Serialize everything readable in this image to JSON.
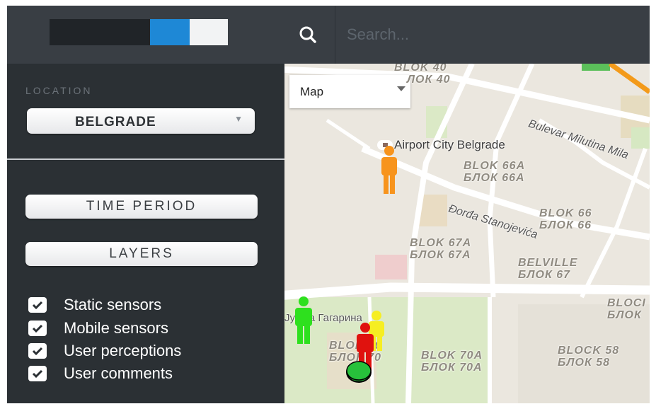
{
  "header": {
    "search_placeholder": "Search...",
    "logo_colors": [
      "#202428",
      "#1e88d6",
      "#f2f3f4"
    ]
  },
  "sidebar": {
    "location_label": "LOCATION",
    "location_value": "BELGRADE",
    "time_period_label": "TIME PERIOD",
    "layers_label": "LAYERS",
    "checkboxes": [
      {
        "label": "Static sensors",
        "checked": true
      },
      {
        "label": "Mobile sensors",
        "checked": true
      },
      {
        "label": "User perceptions",
        "checked": true
      },
      {
        "label": "User comments",
        "checked": true
      }
    ]
  },
  "map": {
    "type_selected": "Map",
    "poi": "Airport City Belgrade",
    "streets": [
      "Bulevar Milutina Mila",
      "Đorđa Stanojevića",
      "Јурија Гагарина"
    ],
    "labels": {
      "blok40_lat": "BLOK 40",
      "blok40_cyr": "ЛОК 40",
      "blok66a_lat": "BLOK 66A",
      "blok66a_cyr": "БЛОК 66А",
      "blok66_lat": "BLOK 66",
      "blok66_cyr": "БЛОК 66",
      "blok67a_lat": "BLOK 67A",
      "blok67a_cyr": "БЛОК 67А",
      "belville_lat": "BELVILLE",
      "belville_cyr": "БЛОК 67",
      "blok70_lat": "BLOK 70",
      "blok70_cyr": "БЛОК 70",
      "blok70a_lat": "BLOK 70A",
      "blok70a_cyr": "БЛОК 70А",
      "block58_lat": "BLOCK 58",
      "block58_cyr": "БЛОК 58",
      "right_lat": "BLOCI",
      "right_cyr": "БЛОК"
    },
    "marker_colors": {
      "orange": "#f7941d",
      "green": "#2ee01e",
      "yellow": "#f6ee22",
      "red": "#e0120e",
      "circle": "#27c13b"
    }
  }
}
